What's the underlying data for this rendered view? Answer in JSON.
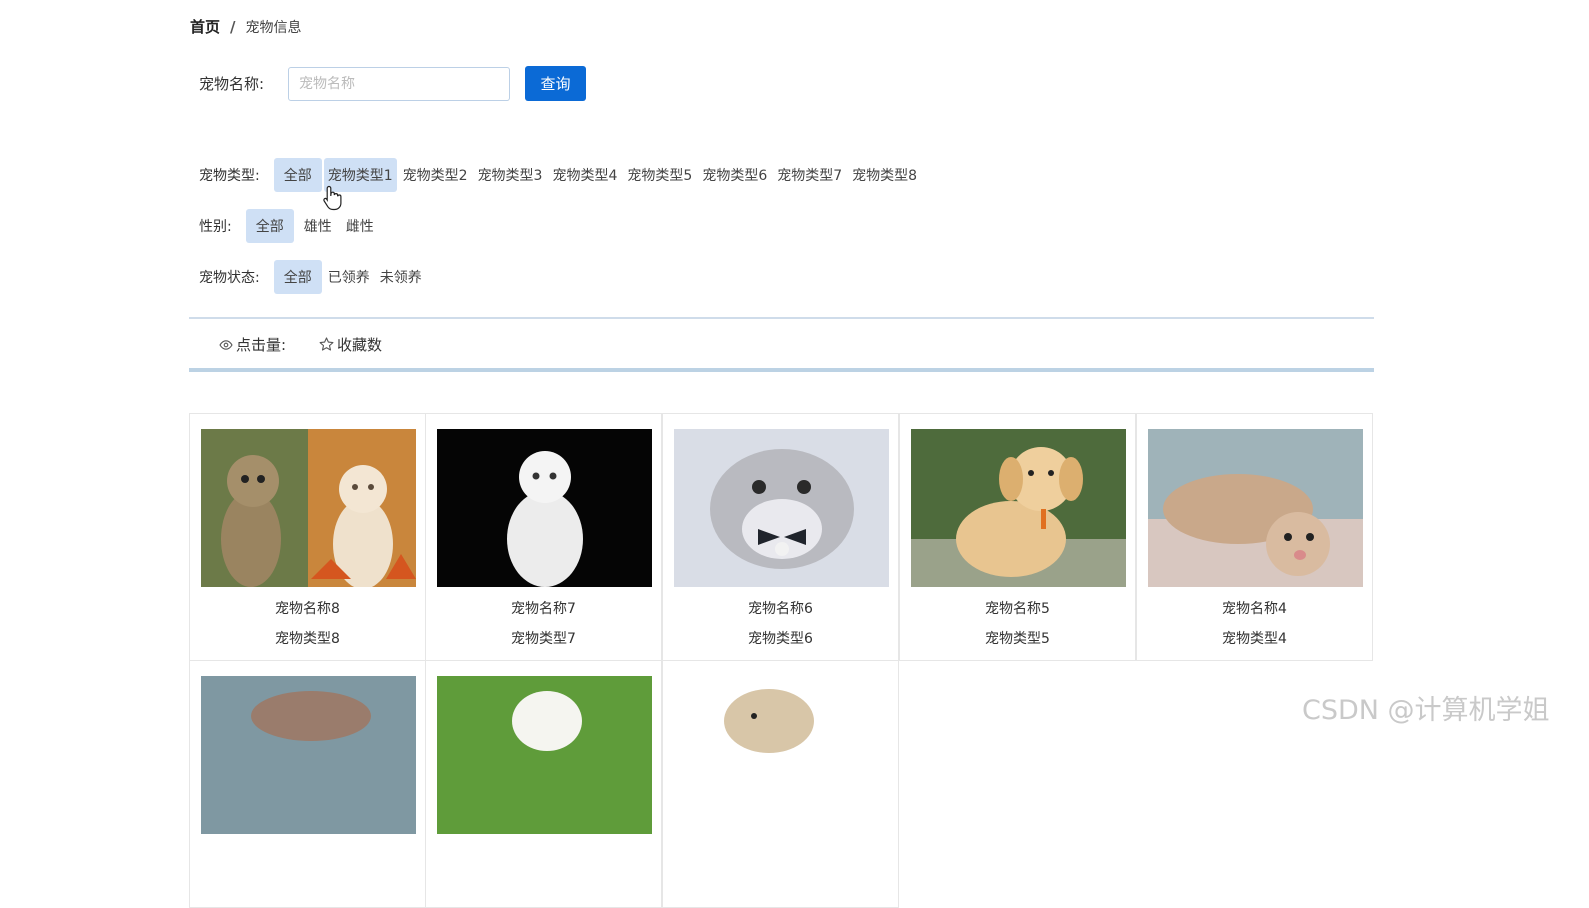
{
  "breadcrumb": {
    "home": "首页",
    "separator": "/",
    "current": "宠物信息"
  },
  "search": {
    "label": "宠物名称:",
    "placeholder": "宠物名称",
    "value": "",
    "button": "查询"
  },
  "filters": {
    "type": {
      "label": "宠物类型:",
      "options": [
        "全部",
        "宠物类型1",
        "宠物类型2",
        "宠物类型3",
        "宠物类型4",
        "宠物类型5",
        "宠物类型6",
        "宠物类型7",
        "宠物类型8"
      ],
      "selected": "全部"
    },
    "sex": {
      "label": "性别:",
      "options": [
        "全部",
        "雄性",
        "雌性"
      ],
      "selected": "全部"
    },
    "status": {
      "label": "宠物状态:",
      "options": [
        "全部",
        "已领养",
        "未领养"
      ],
      "selected": "全部"
    }
  },
  "sort": {
    "views_label": "点击量:",
    "favorites_label": "收藏数",
    "views_icon": "eye-icon",
    "favorites_icon": "star-icon"
  },
  "pets": [
    {
      "name": "宠物名称8",
      "type": "宠物类型8"
    },
    {
      "name": "宠物名称7",
      "type": "宠物类型7"
    },
    {
      "name": "宠物名称6",
      "type": "宠物类型6"
    },
    {
      "name": "宠物名称5",
      "type": "宠物类型5"
    },
    {
      "name": "宠物名称4",
      "type": "宠物类型4"
    },
    {
      "name": "",
      "type": ""
    },
    {
      "name": "",
      "type": ""
    },
    {
      "name": "",
      "type": ""
    }
  ],
  "watermark": "CSDN @计算机学姐",
  "colors": {
    "primary": "#0b6ad6",
    "active_bg": "#cfe0f5"
  }
}
